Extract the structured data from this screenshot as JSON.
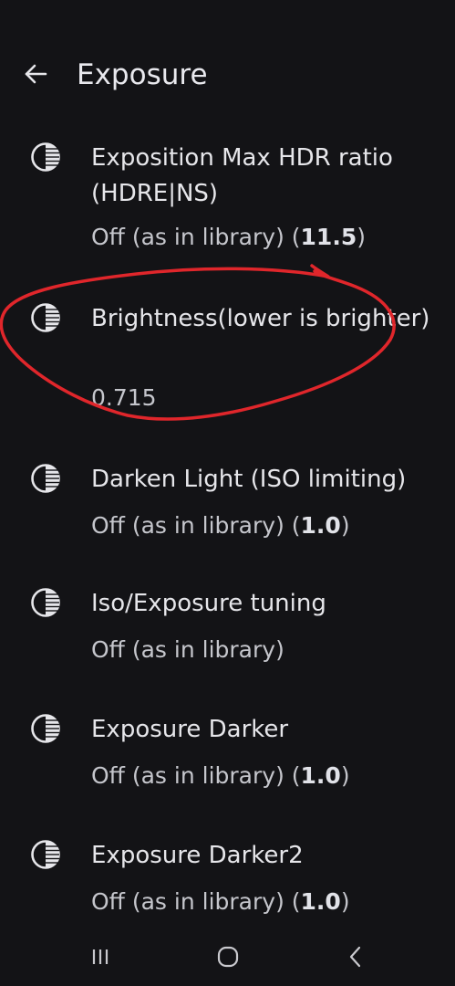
{
  "toolbar": {
    "back_icon": "arrow-back-icon",
    "title": "Exposure"
  },
  "items": [
    {
      "icon": "contrast-icon",
      "title": "Exposition Max HDR ratio (HDRE|NS)",
      "summary": "Off (as in library) (",
      "value": "11.5",
      "suffix": ")"
    },
    {
      "icon": "contrast-icon",
      "title": "Brightness(lower is brighter)",
      "summary": "0.715",
      "value": "",
      "suffix": ""
    },
    {
      "icon": "contrast-icon",
      "title": "Darken Light (ISO limiting)",
      "summary": "Off (as in library) (",
      "value": "1.0",
      "suffix": ")"
    },
    {
      "icon": "contrast-icon",
      "title": "Iso/Exposure tuning",
      "summary": "Off (as in library)",
      "value": "",
      "suffix": ""
    },
    {
      "icon": "contrast-icon",
      "title": "Exposure Darker",
      "summary": "Off (as in library) (",
      "value": "1.0",
      "suffix": ")"
    },
    {
      "icon": "contrast-icon",
      "title": "Exposure Darker2",
      "summary": "Off (as in library) (",
      "value": "1.0",
      "suffix": ")"
    }
  ],
  "annotation": {
    "color": "#e0262b",
    "shape": "hand-drawn-circle"
  },
  "navbar": {
    "recents_icon": "recents-icon",
    "home_icon": "home-icon",
    "back_icon": "nav-back-icon"
  },
  "colors": {
    "background": "#131316",
    "text_primary": "#e6e6ea",
    "text_secondary": "#c5c6cc"
  }
}
